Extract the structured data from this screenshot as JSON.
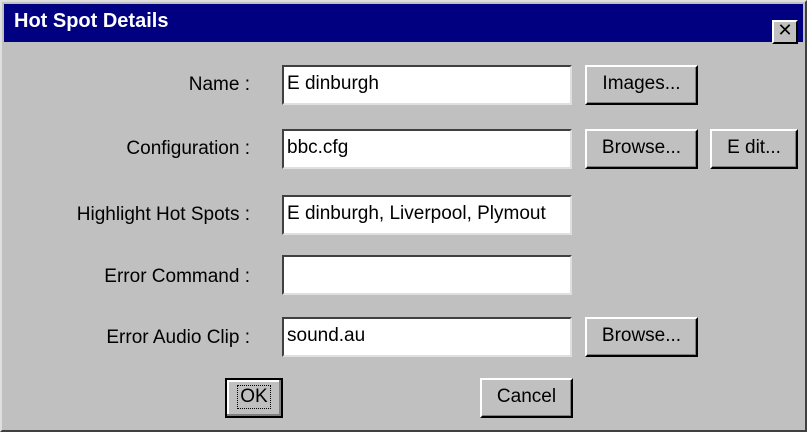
{
  "window": {
    "title": "Hot Spot Details",
    "close_glyph": "✕"
  },
  "fields": {
    "name": {
      "label": "Name :",
      "value": "E dinburgh"
    },
    "configuration": {
      "label": "Configuration :",
      "value": "bbc.cfg"
    },
    "highlight": {
      "label": "Highlight Hot Spots :",
      "value": "E dinburgh, Liverpool, Plymout"
    },
    "error_command": {
      "label": "Error Command :",
      "value": ""
    },
    "error_audio": {
      "label": "Error Audio Clip :",
      "value": "sound.au"
    }
  },
  "buttons": {
    "images": "Images...",
    "browse_config": "Browse...",
    "edit": "E dit...",
    "browse_audio": "Browse...",
    "ok": "OK",
    "cancel": "Cancel"
  },
  "colors": {
    "titlebar": "#000080",
    "face": "#c0c0c0"
  }
}
